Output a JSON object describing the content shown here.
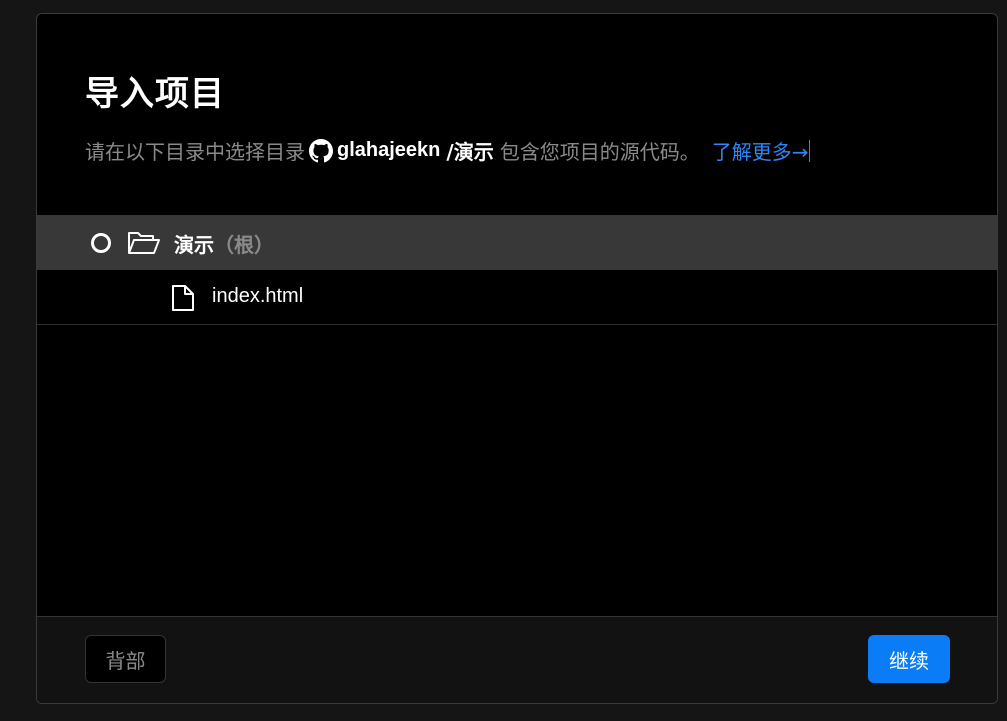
{
  "dialog": {
    "title": "导入项目",
    "subtitle_prefix": "请在以下目录中选择目录",
    "repo_owner": "glahajeekn",
    "repo_path": "/演示",
    "subtitle_suffix": "包含您项目的源代码。",
    "learn_more": "了解更多→"
  },
  "tree": {
    "root": {
      "name": "演示",
      "suffix": "（根）",
      "icon": "folder-open-icon",
      "selected": false
    },
    "files": [
      {
        "name": "index.html",
        "icon": "file-icon"
      }
    ]
  },
  "footer": {
    "back_label": "背部",
    "continue_label": "继续"
  },
  "colors": {
    "accent": "#0a7cf5",
    "link": "#2f86f6",
    "selected_row": "#383838"
  }
}
